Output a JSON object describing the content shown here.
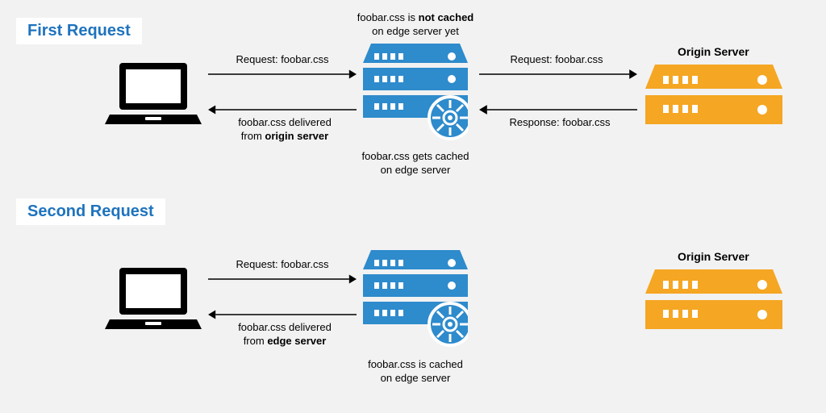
{
  "colors": {
    "accent_blue": "#1e73be",
    "edge_blue": "#2e8bcc",
    "origin_orange": "#f5a623",
    "black": "#000000"
  },
  "filename": "foobar.css",
  "section1": {
    "title": "First Request",
    "edge_caption_top_a": "foobar.css is ",
    "edge_caption_top_b": "not cached",
    "edge_caption_top_c": "on edge server yet",
    "arrow1": "Request: foobar.css",
    "arrow2a": "foobar.css delivered",
    "arrow2b": "from ",
    "arrow2c": "origin server",
    "arrow3": "Request: foobar.css",
    "arrow4": "Response: foobar.css",
    "edge_caption_bot_a": "foobar.css gets cached",
    "edge_caption_bot_b": "on edge server",
    "origin_title": "Origin Server"
  },
  "section2": {
    "title": "Second Request",
    "arrow1": "Request: foobar.css",
    "arrow2a": "foobar.css delivered",
    "arrow2b": "from ",
    "arrow2c": "edge server",
    "edge_caption_bot_a": "foobar.css is cached",
    "edge_caption_bot_b": "on edge server",
    "origin_title": "Origin Server"
  }
}
